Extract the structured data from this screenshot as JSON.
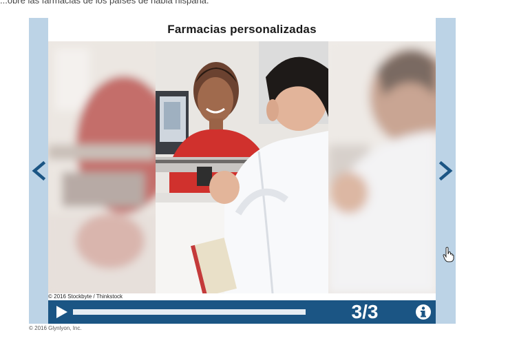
{
  "page": {
    "top_caption": "...obre las farmacias de los países de habla hispana.",
    "bottom_caption": "© 2016 Glynlyon, Inc."
  },
  "slideshow": {
    "title": "Farmacias personalizadas",
    "photo_credit": "© 2016 Stockbyte / Thinkstock",
    "prev_icon": "chevron-left-icon",
    "next_icon": "chevron-right-icon",
    "counter": "3/3",
    "progress": 1.0,
    "colors": {
      "frame": "#bcd3e6",
      "bar": "#1b5584",
      "arrow": "#1b5584"
    }
  }
}
